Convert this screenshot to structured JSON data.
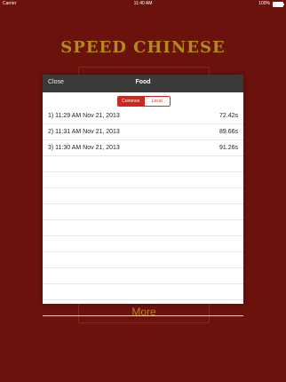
{
  "status": {
    "carrier": "Carrier",
    "time": "11:40 AM",
    "battery": "100%"
  },
  "background": {
    "title": "SPEED CHINESE",
    "top_button_label": "",
    "bottom_button_label": "More"
  },
  "modal": {
    "close_label": "Close",
    "title": "Food",
    "segments": {
      "common": "Common",
      "local": "Local",
      "selected": "Common"
    },
    "rows": [
      {
        "label": "1) 11:29 AM Nov 21, 2013",
        "value": "72.42s"
      },
      {
        "label": "2) 11:31 AM Nov 21, 2013",
        "value": "89.66s"
      },
      {
        "label": "3) 11:30 AM Nov 21, 2013",
        "value": "91.26s"
      }
    ]
  },
  "colors": {
    "background": "#6b120d",
    "accent": "#c92a1e",
    "title_gold": "#b38a1b"
  },
  "icons": {
    "wifi": "wifi-icon",
    "battery": "battery-icon"
  }
}
